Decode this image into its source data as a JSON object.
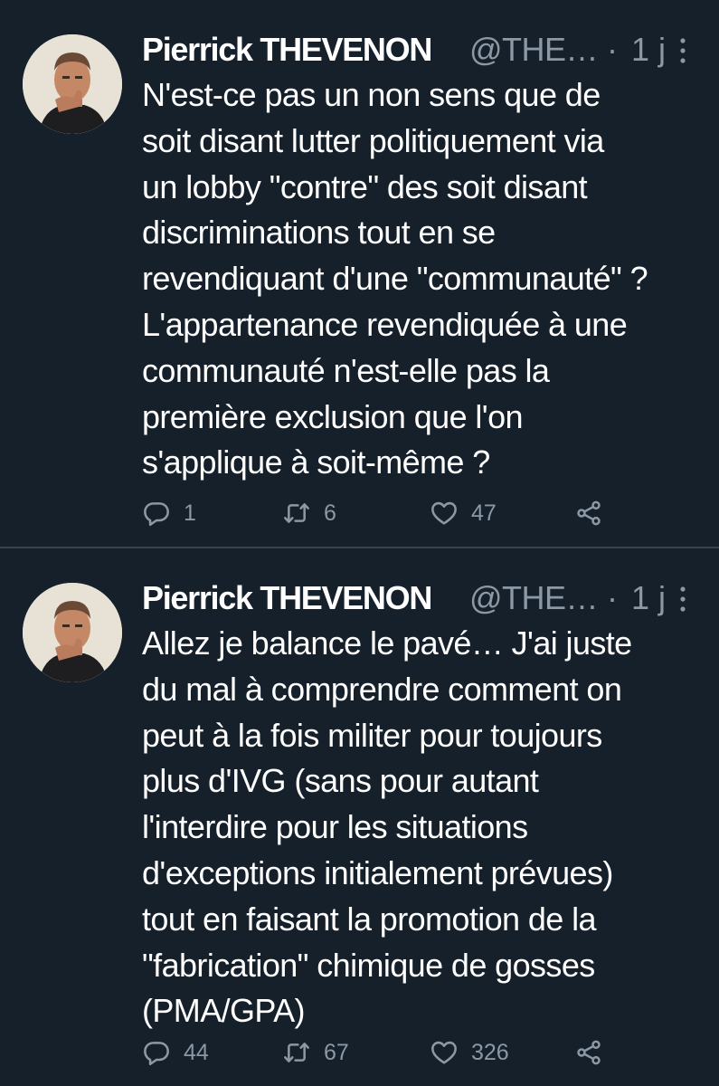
{
  "tweets": [
    {
      "author_name": "Pierrick THEVENON",
      "handle": "@THE…",
      "separator": "·",
      "time": "1 j",
      "text_lines": [
        "N'est-ce pas un non sens que de",
        "soit disant lutter politiquement via",
        "un lobby \"contre\" des soit disant",
        "discriminations tout en se",
        "revendiquant d'une \"communauté\" ?",
        "L'appartenance revendiquée à une",
        "communauté n'est-elle pas la",
        "première exclusion que l'on",
        "s'applique à soit-même ?"
      ],
      "replies": "1",
      "retweets": "6",
      "likes": "47"
    },
    {
      "author_name": "Pierrick THEVENON",
      "handle": "@THE…",
      "separator": "·",
      "time": "1 j",
      "text_lines": [
        "Allez je balance le pavé… J'ai juste",
        "du mal à comprendre comment on",
        "peut à la fois militer pour toujours",
        "plus d'IVG (sans pour autant",
        "l'interdire pour les situations",
        "d'exceptions initialement prévues)",
        "tout en faisant la promotion de la",
        "\"fabrication\" chimique de gosses",
        "(PMA/GPA)"
      ],
      "replies": "44",
      "retweets": "67",
      "likes": "326"
    }
  ],
  "icons": {
    "reply": "reply-icon",
    "retweet": "retweet-icon",
    "like": "heart-icon",
    "share": "share-icon",
    "more": "more-vertical-icon"
  },
  "colors": {
    "background": "#15202b",
    "text_primary": "#ffffff",
    "text_secondary": "#8b98a5",
    "divider": "#38444d"
  }
}
